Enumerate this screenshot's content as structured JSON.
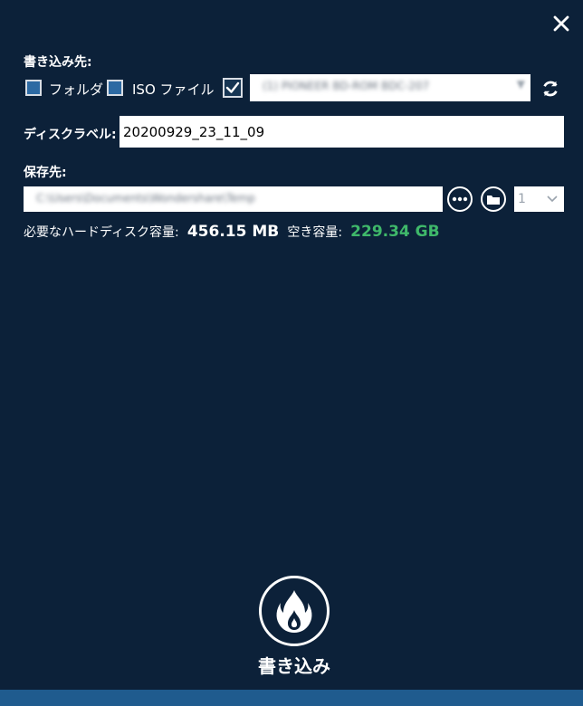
{
  "write_to": {
    "label": "書き込み先:",
    "folder_label": "フォルダ",
    "iso_label": "ISO ファイル",
    "folder_checked": false,
    "iso_checked": false,
    "drive_checked": true,
    "drive_placeholder": "(1) PIONEER BD-ROM BDC-207"
  },
  "disc_label": {
    "label": "ディスクラベル:",
    "value": "20200929_23_11_09"
  },
  "save_to": {
    "label": "保存先:",
    "path": "C:\\Users\\Documents\\Wondershare\\Temp",
    "count_value": "1"
  },
  "info": {
    "required_label": "必要なハードディスク容量:",
    "required_value": "456.15 MB",
    "free_label": "空き容量:",
    "free_value": "229.34 GB"
  },
  "burn": {
    "label": "書き込み"
  },
  "colors": {
    "background": "#0c2139",
    "free_space": "#3fb86a",
    "checkbox_fill": "#2d6aa3",
    "bottom_bar": "#1f5b8e"
  },
  "icons": [
    "close-icon",
    "refresh-icon",
    "more-icon",
    "folder-icon",
    "chevron-down-icon",
    "flame-icon"
  ]
}
